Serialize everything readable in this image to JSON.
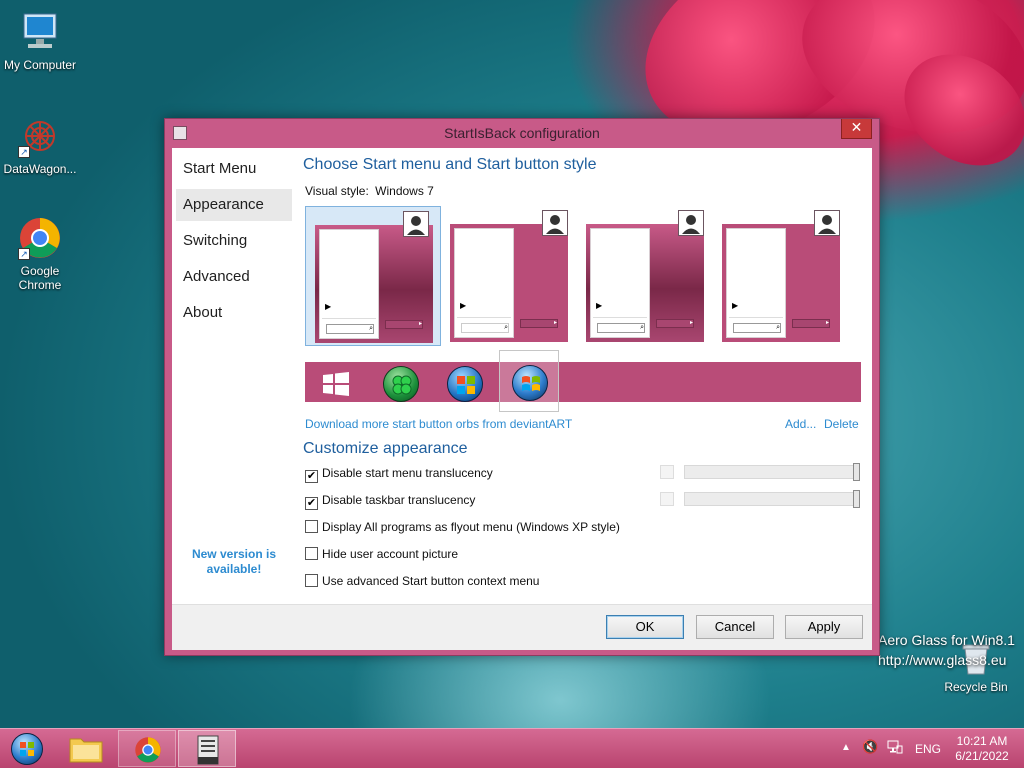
{
  "desktop": {
    "icons": [
      {
        "label": "My Computer"
      },
      {
        "label": "DataWagon..."
      },
      {
        "label": "Google Chrome"
      },
      {
        "label": "Recycle Bin"
      }
    ],
    "watermark_line1": "Aero Glass for Win8.1",
    "watermark_line2": "http://www.glass8.eu"
  },
  "dialog": {
    "title": "StartIsBack configuration",
    "close_label": "✕",
    "nav": [
      {
        "label": "Start Menu"
      },
      {
        "label": "Appearance"
      },
      {
        "label": "Switching"
      },
      {
        "label": "Advanced"
      },
      {
        "label": "About"
      }
    ],
    "selected_nav": "Appearance",
    "new_version_text": "New version is available!",
    "style_heading": "Choose Start menu and Start button style",
    "visual_style_label": "Visual style:",
    "visual_style_value": "Windows 7",
    "download_link": "Download more start button orbs from deviantART",
    "add_link": "Add...",
    "delete_link": "Delete",
    "customize_heading": "Customize appearance",
    "options": [
      {
        "label": "Disable start menu translucency",
        "checked": true
      },
      {
        "label": "Disable taskbar translucency",
        "checked": true
      },
      {
        "label": "Display All programs as flyout menu (Windows XP style)",
        "checked": false
      },
      {
        "label": "Hide user account picture",
        "checked": false
      },
      {
        "label": "Use advanced Start button context menu",
        "checked": false
      }
    ],
    "check_mark": "✔",
    "buttons": {
      "ok": "OK",
      "cancel": "Cancel",
      "apply": "Apply"
    }
  },
  "taskbar": {
    "language": "ENG",
    "time": "10:21 AM",
    "date": "6/21/2022"
  },
  "colors": {
    "accent": "#b94c78",
    "link": "#2d8bd0",
    "heading": "#1f5f9e"
  }
}
